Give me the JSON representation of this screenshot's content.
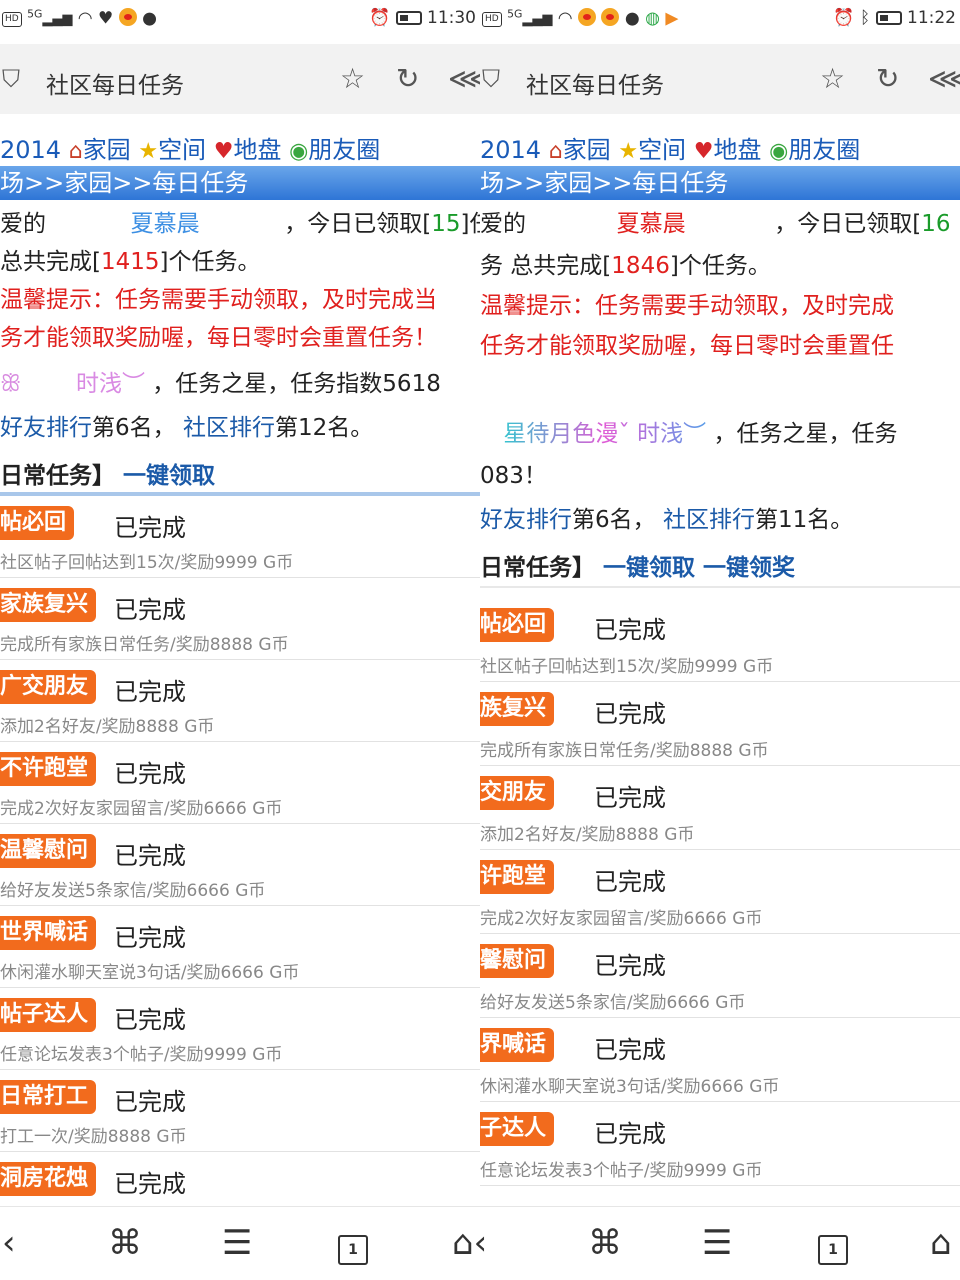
{
  "left": {
    "status": {
      "time": "11:30",
      "net": "5G"
    },
    "toolbar": {
      "title": "社区每日任务"
    },
    "nav": {
      "year": "2014",
      "items": [
        "家园",
        "空间",
        "地盘",
        "朋友圈"
      ]
    },
    "breadcrumb": "场>>家园>>每日任务",
    "greeting": {
      "prefix": "爱的",
      "name": "夏慕晨",
      "middle": "，今日已领取[",
      "count": "15",
      "suffix": "]任"
    },
    "total": {
      "prefix": "总共完成[",
      "count": "1415",
      "suffix": "]个任务。"
    },
    "tip": {
      "line1": "温馨提示：任务需要手动领取，及时完成当",
      "line2": "务才能领取奖励喔，每日零时会重置任务！"
    },
    "star": {
      "name": "时浅︶",
      "text": "，任务之星，任务指数5618"
    },
    "rank": {
      "friend_label": "好友排行",
      "friend_value": "第6名，",
      "community_label": "社区排行",
      "community_value": "第12名。"
    },
    "daily": {
      "title": "日常任务】",
      "action1": "一键领取"
    },
    "tasks": [
      {
        "badge": "帖必回",
        "status": "已完成",
        "desc": "社区帖子回帖达到15次/奖励9999 G币"
      },
      {
        "badge": "家族复兴",
        "status": "已完成",
        "desc": "完成所有家族日常任务/奖励8888 G币"
      },
      {
        "badge": "广交朋友",
        "status": "已完成",
        "desc": "添加2名好友/奖励8888 G币"
      },
      {
        "badge": "不许跑堂",
        "status": "已完成",
        "desc": "完成2次好友家园留言/奖励6666 G币"
      },
      {
        "badge": "温馨慰问",
        "status": "已完成",
        "desc": "给好友发送5条家信/奖励6666 G币"
      },
      {
        "badge": "世界喊话",
        "status": "已完成",
        "desc": "休闲灌水聊天室说3句话/奖励6666 G币"
      },
      {
        "badge": "帖子达人",
        "status": "已完成",
        "desc": "任意论坛发表3个帖子/奖励9999 G币"
      },
      {
        "badge": "日常打工",
        "status": "已完成",
        "desc": "打工一次/奖励8888 G币"
      },
      {
        "badge": "洞房花烛",
        "status": "已完成",
        "desc": ""
      }
    ]
  },
  "right": {
    "status": {
      "time": "11:22",
      "net": "5G"
    },
    "toolbar": {
      "title": "社区每日任务"
    },
    "nav": {
      "year": "2014",
      "items": [
        "家园",
        "空间",
        "地盘",
        "朋友圈"
      ]
    },
    "breadcrumb": "场>>家园>>每日任务",
    "greeting": {
      "prefix": "爱的",
      "name": "夏慕晨",
      "middle": "，今日已领取[",
      "count": "16",
      "suffix": ""
    },
    "total": {
      "prefix": "务 总共完成[",
      "count": "1846",
      "suffix": "]个任务。"
    },
    "tip": {
      "line1": "温馨提示：任务需要手动领取，及时完成",
      "line2": "任务才能领取奖励喔，每日零时会重置任"
    },
    "star": {
      "name": "星待月色漫ˇ 时浅︶",
      "text": "，任务之星，任务",
      "line2": "083！"
    },
    "rank": {
      "friend_label": "好友排行",
      "friend_value": "第6名，",
      "community_label": "社区排行",
      "community_value": "第11名。"
    },
    "daily": {
      "title": "日常任务】",
      "action1": "一键领取",
      "action2": "一键领奖"
    },
    "tasks": [
      {
        "badge": "帖必回",
        "status": "已完成",
        "desc": "社区帖子回帖达到15次/奖励9999 G币"
      },
      {
        "badge": "族复兴",
        "status": "已完成",
        "desc": "完成所有家族日常任务/奖励8888 G币"
      },
      {
        "badge": "交朋友",
        "status": "已完成",
        "desc": "添加2名好友/奖励8888 G币"
      },
      {
        "badge": "许跑堂",
        "status": "已完成",
        "desc": "完成2次好友家园留言/奖励6666 G币"
      },
      {
        "badge": "馨慰问",
        "status": "已完成",
        "desc": "给好友发送5条家信/奖励6666 G币"
      },
      {
        "badge": "界喊话",
        "status": "已完成",
        "desc": "休闲灌水聊天室说3句话/奖励6666 G币"
      },
      {
        "badge": "子达人",
        "status": "已完成",
        "desc": "任意论坛发表3个帖子/奖励9999 G币"
      }
    ]
  },
  "colors": {
    "badge": "#f26b1d",
    "link": "#1b5aa8",
    "red": "#e0201e",
    "crumb": "#2e75d6"
  },
  "icons": [
    "shield-icon",
    "star-icon",
    "refresh-icon",
    "share-icon",
    "back-icon",
    "apps-icon",
    "tabs-icon",
    "page-icon",
    "home-icon"
  ]
}
